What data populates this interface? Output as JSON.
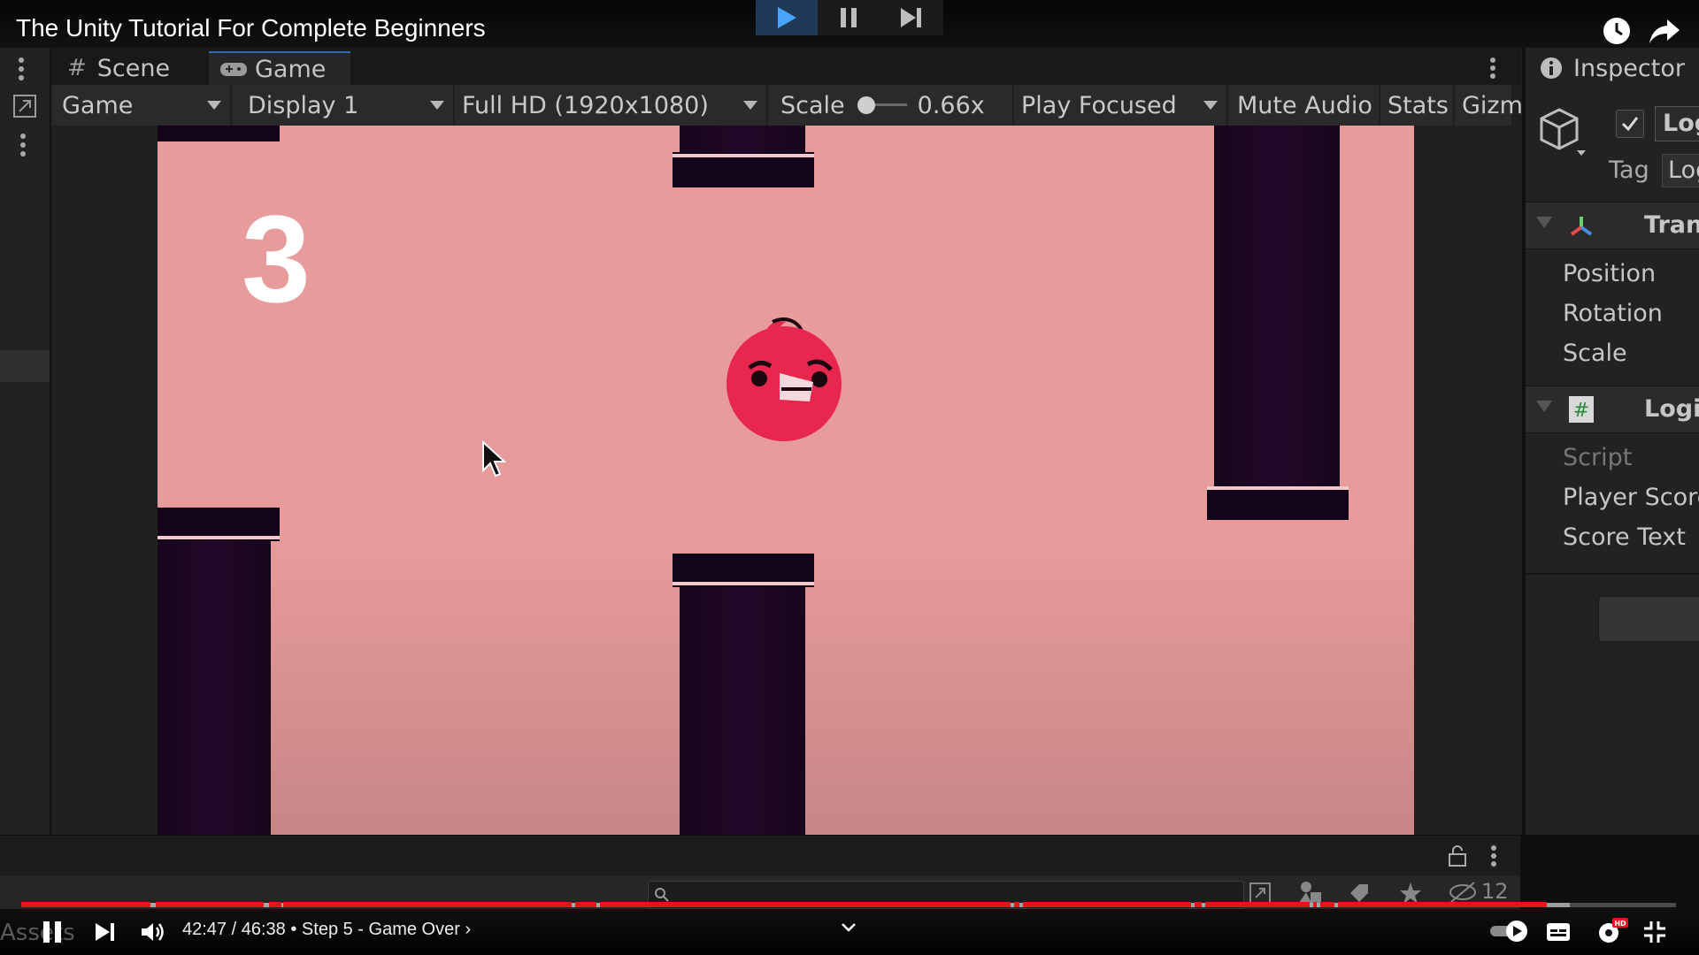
{
  "video": {
    "title": "The Unity Tutorial For Complete Beginners",
    "time": "42:47 / 46:38",
    "separator": "•",
    "chapter": "Step 5 - Game Over",
    "chapter_chevron": "›",
    "progress_fraction": 0.917
  },
  "editor": {
    "tabs": {
      "scene": "Scene",
      "game": "Game"
    },
    "toolbar": {
      "view_mode": "Game",
      "display": "Display 1",
      "resolution": "Full HD (1920x1080)",
      "scale_label": "Scale",
      "scale_value": "0.66x",
      "play_mode": "Play Focused",
      "mute": "Mute Audio",
      "stats": "Stats",
      "gizmos": "Gizmos"
    },
    "game": {
      "score": "3"
    },
    "inspector": {
      "title": "Inspector",
      "object_name": "Log",
      "tag_label": "Tag",
      "tag_value": "Log",
      "transform_title": "Trans",
      "transform_fields": [
        "Position",
        "Rotation",
        "Scale"
      ],
      "logic_title": "Logic",
      "logic_fields": [
        "Script",
        "Player Score",
        "Score Text"
      ]
    },
    "bottom": {
      "assets_label": "Assets",
      "hidden_count": "12"
    }
  },
  "icons": [
    "play-icon",
    "pause-icon",
    "step-icon",
    "watch-later-icon",
    "share-icon",
    "grid-icon",
    "gamepad-icon",
    "kebab-icon",
    "info-icon",
    "cube-icon",
    "checkbox-icon",
    "transform-axes-icon",
    "script-hash-icon",
    "lock-icon",
    "search-icon",
    "hd-icon",
    "settings-icon",
    "subtitles-icon",
    "autoplay-toggle-icon",
    "exit-fullscreen-icon",
    "volume-icon",
    "next-icon",
    "chevron-down-icon"
  ],
  "colors": {
    "accent_red": "#e4131c",
    "sky": "#e89b9b",
    "pipe": "#1a0620",
    "bird": "#e8274f"
  }
}
